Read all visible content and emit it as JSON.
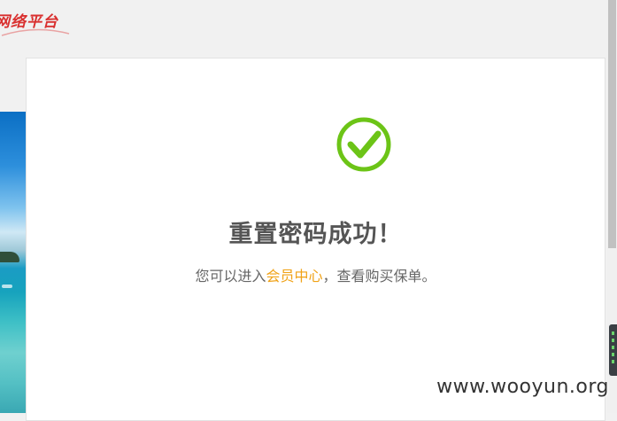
{
  "brand": {
    "logo_text": "网络平台"
  },
  "success": {
    "icon": "check-circle-icon",
    "title": "重置密码成功！",
    "message_prefix": "您可以进入",
    "link_text": "会员中心",
    "message_suffix": "，查看购买保单。"
  },
  "colors": {
    "check_green": "#6cc417",
    "link_orange": "#f0a216",
    "title_gray": "#555555",
    "brand_red": "#d9302f"
  },
  "watermark": "www.wooyun.org"
}
